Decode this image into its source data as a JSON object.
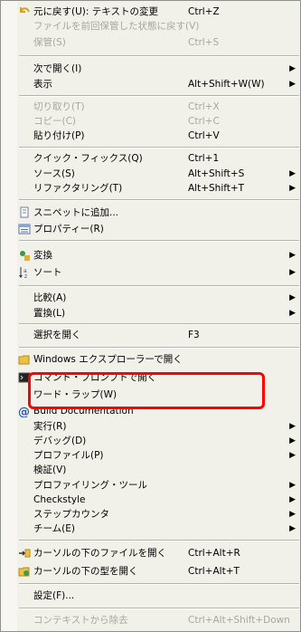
{
  "menu": {
    "undo": {
      "label": "元に戻す(U): テキストの変更",
      "shortcut": "Ctrl+Z",
      "icon": "undo-icon"
    },
    "revert": {
      "label": "ファイルを前回保管した状態に戻す(V)"
    },
    "save": {
      "label": "保管(S)",
      "shortcut": "Ctrl+S"
    },
    "open_with": {
      "label": "次で開く(I)"
    },
    "show_in": {
      "label": "表示",
      "shortcut": "Alt+Shift+W(W)"
    },
    "cut": {
      "label": "切り取り(T)",
      "shortcut": "Ctrl+X"
    },
    "copy": {
      "label": "コピー(C)",
      "shortcut": "Ctrl+C"
    },
    "paste": {
      "label": "貼り付け(P)",
      "shortcut": "Ctrl+V"
    },
    "quick_fix": {
      "label": "クイック・フィックス(Q)",
      "shortcut": "Ctrl+1"
    },
    "source": {
      "label": "ソース(S)",
      "shortcut": "Alt+Shift+S"
    },
    "refactor": {
      "label": "リファクタリング(T)",
      "shortcut": "Alt+Shift+T"
    },
    "add_snippet": {
      "label": "スニペットに追加...",
      "icon": "snippet-icon"
    },
    "properties": {
      "label": "プロパティー(R)",
      "icon": "properties-icon"
    },
    "convert": {
      "label": "変換",
      "icon": "convert-icon"
    },
    "sort": {
      "label": "ソート",
      "icon": "sort-icon"
    },
    "compare": {
      "label": "比較(A)"
    },
    "replace": {
      "label": "置換(L)"
    },
    "open_selection": {
      "label": "選択を開く",
      "shortcut": "F3"
    },
    "open_explorer": {
      "label": "Windows エクスプローラーで開く",
      "icon": "folder-icon"
    },
    "open_cmd": {
      "label": "コマンド・プロンプトで開く",
      "icon": "console-icon"
    },
    "word_wrap": {
      "label": "ワード・ラップ(W)"
    },
    "build_doc": {
      "label": "Build Documentation",
      "icon": "at-icon"
    },
    "run": {
      "label": "実行(R)"
    },
    "debug": {
      "label": "デバッグ(D)"
    },
    "profile": {
      "label": "プロファイル(P)"
    },
    "validate": {
      "label": "検証(V)"
    },
    "profiling_tools": {
      "label": "プロファイリング・ツール"
    },
    "checkstyle": {
      "label": "Checkstyle"
    },
    "step_counter": {
      "label": "ステップカウンタ"
    },
    "team": {
      "label": "チーム(E)"
    },
    "open_file_under_cursor": {
      "label": "カーソルの下のファイルを開く",
      "shortcut": "Ctrl+Alt+R",
      "icon": "open-file-icon"
    },
    "open_type_under_cursor": {
      "label": "カーソルの下の型を開く",
      "shortcut": "Ctrl+Alt+T",
      "icon": "open-type-icon"
    },
    "settings": {
      "label": "設定(F)..."
    },
    "remove_context": {
      "label": "コンテキストから除去",
      "shortcut": "Ctrl+Alt+Shift+Down"
    }
  },
  "colors": {
    "highlight": "#ff0000",
    "menu_bg": "#f1f0e9",
    "disabled": "#a7a6a0"
  }
}
